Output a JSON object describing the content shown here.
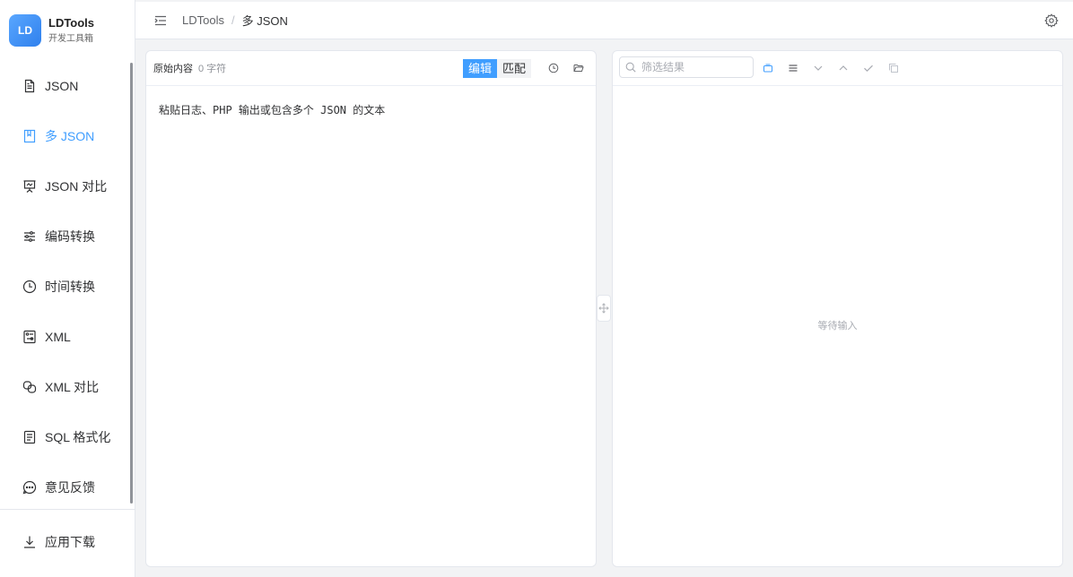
{
  "brand": {
    "logo": "LD",
    "name": "LDTools",
    "subtitle": "开发工具箱"
  },
  "sidebar": {
    "items": [
      {
        "label": "JSON",
        "icon": "document-icon"
      },
      {
        "label": "多 JSON",
        "icon": "book-icon",
        "active": true
      },
      {
        "label": "JSON 对比",
        "icon": "presentation-icon"
      },
      {
        "label": "编码转换",
        "icon": "sliders-icon"
      },
      {
        "label": "时间转换",
        "icon": "clock-icon"
      },
      {
        "label": "XML",
        "icon": "tag-box-icon"
      },
      {
        "label": "XML 对比",
        "icon": "link-icon"
      },
      {
        "label": "SQL 格式化",
        "icon": "list-doc-icon"
      },
      {
        "label": "意见反馈",
        "icon": "chat-icon"
      }
    ],
    "bottom": {
      "label": "应用下载",
      "icon": "download-icon"
    }
  },
  "header": {
    "breadcrumb": [
      "LDTools",
      "多 JSON"
    ],
    "separator": "/"
  },
  "left_panel": {
    "title": "原始内容",
    "count": "0 字符",
    "mode_edit": "编辑",
    "mode_match": "匹配",
    "placeholder": "粘贴日志、PHP 输出或包含多个 JSON 的文本"
  },
  "right_panel": {
    "search_placeholder": "筛选结果",
    "empty_text": "等待输入"
  },
  "colors": {
    "accent": "#409eff",
    "logo_bg": "#3b8ff0"
  }
}
